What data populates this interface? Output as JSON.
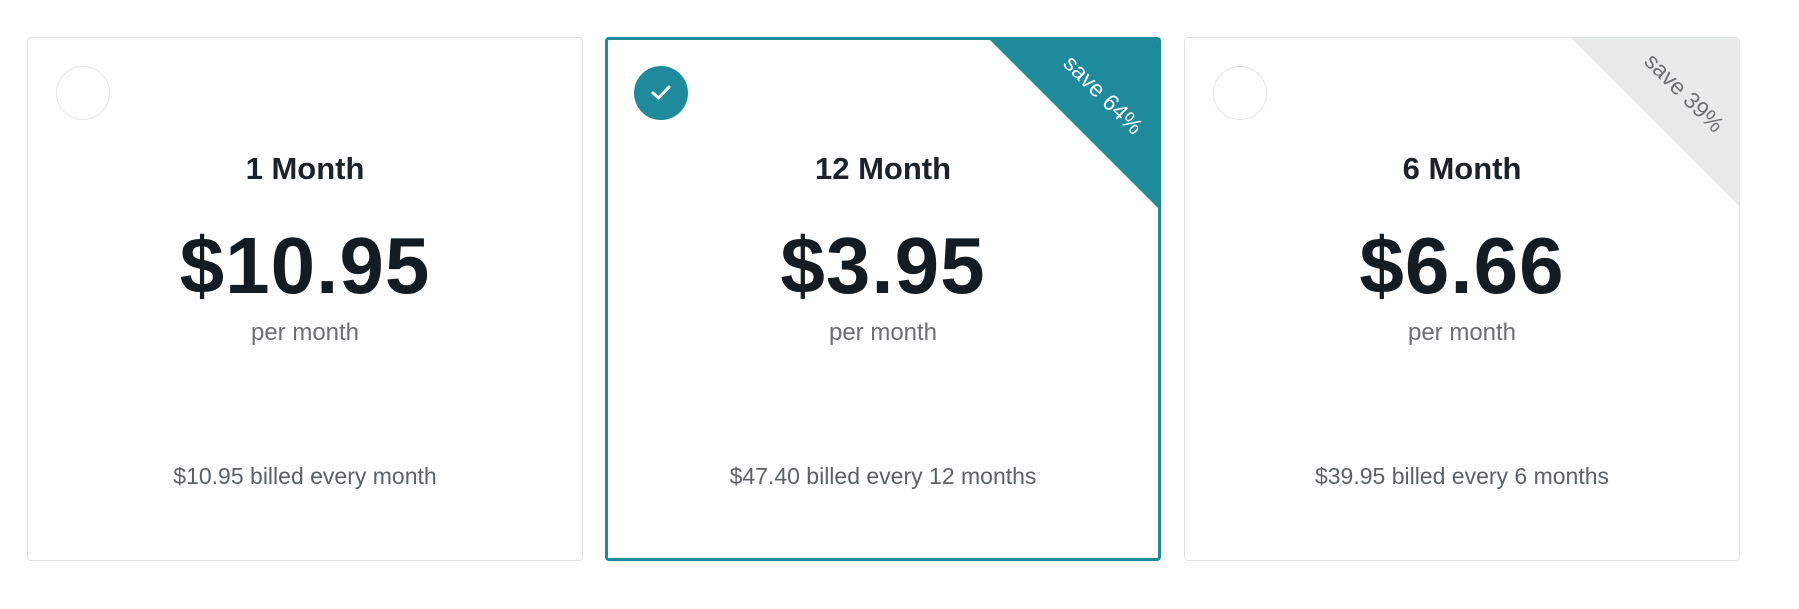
{
  "colors": {
    "accent": "#1f8a9c",
    "muted_ribbon": "#e9ebeb",
    "card_border": "#e2e5e6"
  },
  "plans": [
    {
      "name": "1 Month",
      "price": "$10.95",
      "period": "per month",
      "billing": "$10.95 billed every month",
      "selected": false,
      "badge": ""
    },
    {
      "name": "12 Month",
      "price": "$3.95",
      "period": "per month",
      "billing": "$47.40 billed every 12 months",
      "selected": true,
      "badge": "save 64%"
    },
    {
      "name": "6 Month",
      "price": "$6.66",
      "period": "per month",
      "billing": "$39.95 billed every 6 months",
      "selected": false,
      "badge": "save 39%"
    }
  ],
  "icons": {
    "selected_indicator": "checkmark-icon",
    "unselected_indicator": "radio-circle-icon"
  }
}
